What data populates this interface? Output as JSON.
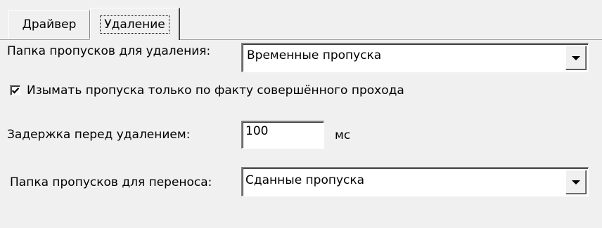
{
  "tabs": [
    {
      "label": "Драйвер",
      "active": false
    },
    {
      "label": "Удаление",
      "active": true
    }
  ],
  "delete_folder": {
    "label": "Папка пропусков для удаления:",
    "value": "Временные пропуска"
  },
  "confiscate_option": {
    "label": "Изымать пропуска только по факту совершённого прохода",
    "checked": true
  },
  "delete_delay": {
    "label": "Задержка перед удалением:",
    "value": "100",
    "unit": "мс"
  },
  "transfer_folder": {
    "label": "Папка пропусков для переноса:",
    "value": "Сданные пропуска"
  }
}
